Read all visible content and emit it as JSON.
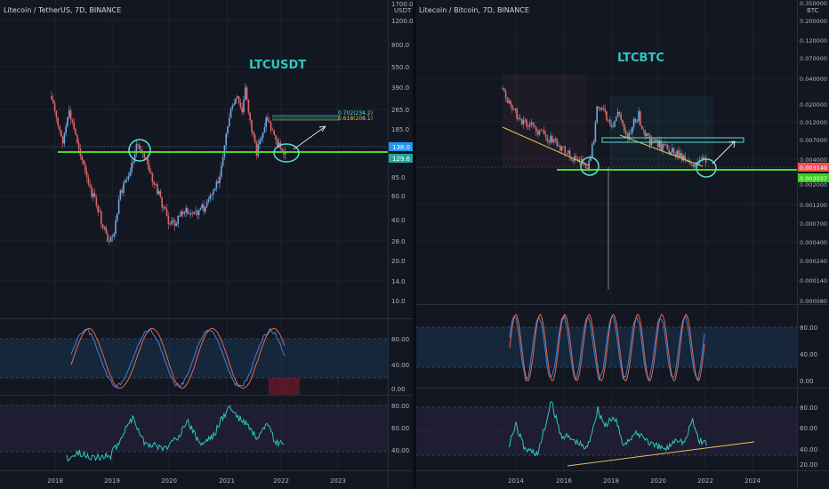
{
  "colors": {
    "background": "#131722",
    "grid": "#1e222d",
    "separator": "#2a2e39",
    "axis_text": "#b2b5be",
    "candle_up": "#6fa8dc",
    "candle_down": "#e06666",
    "support": "#4dd827",
    "annotation_cyan": "#5ee0d8",
    "fib": "#e8c547",
    "stoch_k": "#4a7dd6",
    "stoch_d": "#e0694f",
    "rsi": "#2ec8c0",
    "trendline_yellow": "#e6c15a",
    "stoch_band": "#1b3a5c",
    "rsi_band": "#2a2340",
    "price_badge_blue": "#2196f3",
    "price_badge_green": "#26a69a",
    "price_badge_red": "#ef5350",
    "price_badge_lime": "#33d117"
  },
  "left_panel": {
    "header": "Litecoin / TetherUS, 7D, BINANCE",
    "chart_label": "LTCUSDT",
    "unit": "USDT",
    "price_ticks": [
      "1700.0",
      "1200.0",
      "800.0",
      "550.0",
      "390.0",
      "265.0",
      "185.0",
      "138.0",
      "129.6",
      "85.0",
      "60.0",
      "40.0",
      "28.0",
      "20.0",
      "14.0",
      "10.0"
    ],
    "badges": [
      {
        "label": "138.0",
        "kind": "blue"
      },
      {
        "label": "129.6",
        "kind": "green"
      }
    ],
    "fib_labels": [
      "0.702(234.2)",
      "0.618(208.1)"
    ],
    "stoch_ticks": [
      "80.00",
      "40.00",
      "0.00"
    ],
    "rsi_ticks": [
      "80.00",
      "60.00",
      "40.00"
    ],
    "x_ticks": [
      "2018",
      "2019",
      "2020",
      "2021",
      "2022",
      "2023"
    ]
  },
  "right_panel": {
    "header": "Litecoin / Bitcoin, 7D, BINANCE",
    "chart_label": "LTCBTC",
    "unit": "BTC",
    "price_ticks": [
      "0.350000",
      "0.200000",
      "0.120000",
      "0.070000",
      "0.040000",
      "0.020000",
      "0.012000",
      "0.007000",
      "0.004000",
      "0.003149",
      "0.003037",
      "0.002000",
      "0.001200",
      "0.000700",
      "0.000400",
      "0.000240",
      "0.000140",
      "0.000080"
    ],
    "badges": [
      {
        "label": "0.003149",
        "kind": "red"
      },
      {
        "label": "0.003037",
        "kind": "lime"
      }
    ],
    "stoch_ticks": [
      "80.00",
      "40.00",
      "0.00"
    ],
    "rsi_ticks": [
      "80.00",
      "60.00",
      "40.00",
      "20.00"
    ],
    "x_ticks": [
      "2014",
      "2016",
      "2018",
      "2020",
      "2022",
      "2024"
    ]
  }
}
